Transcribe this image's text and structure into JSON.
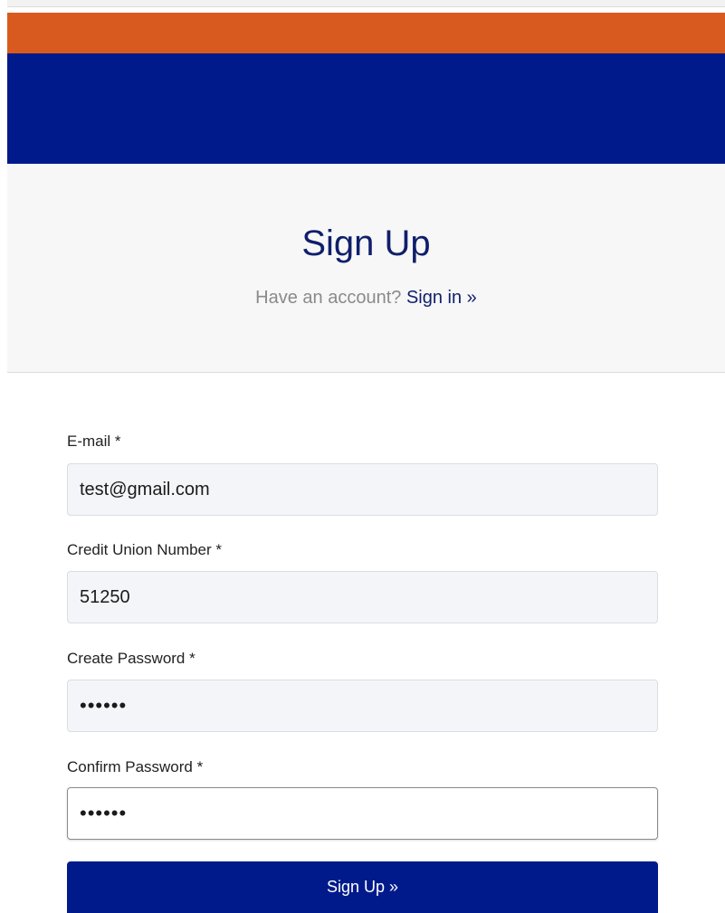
{
  "colors": {
    "orange_band": "#d85a1e",
    "blue_band": "#001a8b",
    "title": "#0f1f6b",
    "button_bg": "#001a8b"
  },
  "header": {
    "title": "Sign Up",
    "have_account_text": "Have an account?",
    "signin_link": "Sign in »"
  },
  "form": {
    "email": {
      "label": "E-mail *",
      "value": "test@gmail.com"
    },
    "cu_number": {
      "label": "Credit Union Number *",
      "value": "51250"
    },
    "create_password": {
      "label": "Create Password *",
      "value": "••••••"
    },
    "confirm_password": {
      "label": "Confirm Password *",
      "value": "••••••"
    },
    "submit_label": "Sign Up »"
  }
}
